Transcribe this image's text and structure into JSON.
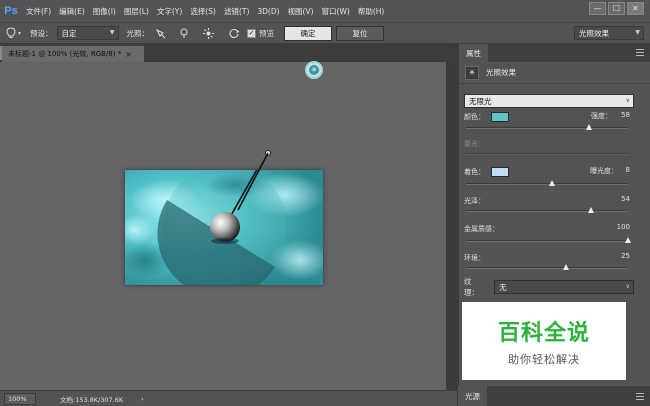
{
  "app": {
    "logo": "Ps"
  },
  "menu": [
    "文件(F)",
    "编辑(E)",
    "图像(I)",
    "图层(L)",
    "文字(Y)",
    "选择(S)",
    "滤镜(T)",
    "3D(D)",
    "视图(V)",
    "窗口(W)",
    "帮助(H)"
  ],
  "window_controls": {
    "minimize": "—",
    "maximize": "☐",
    "close": "✕"
  },
  "options": {
    "preset_label": "预设：",
    "preset_value": "自定",
    "light_label": "光照：",
    "preview_label": "预览",
    "preview_checked": true,
    "ok_label": "确定",
    "reset_label": "复位",
    "workspace_value": "光照效果"
  },
  "document": {
    "tab_title": "未标题-1 @ 100% (光效, RGB/8) *",
    "close": "×"
  },
  "status": {
    "zoom": "100%",
    "doc_size": "文档:153.8K/307.6K",
    "arrow": "›"
  },
  "panel": {
    "tab": "属性",
    "title": "光照效果",
    "light_type": "无限光",
    "color_label": "颜色：",
    "intensity_label": "强度：",
    "intensity": "58",
    "intensity_pct": 0.76,
    "hotspot_label": "聚光：",
    "coloring_label": "着色：",
    "exposure_label": "曝光度：",
    "exposure": "8",
    "exposure_pct": 0.53,
    "gloss_label": "光泽：",
    "gloss": "54",
    "gloss_pct": 0.77,
    "metallic_label": "金属质感：",
    "metallic": "100",
    "metallic_pct": 1.0,
    "ambience_label": "环境：",
    "ambience": "25",
    "ambience_pct": 0.62,
    "texture_label": "纹理：",
    "texture_value": "无",
    "bottom_tab": "光源",
    "colors": {
      "light_color": "#5fc4c7",
      "coloring_color": "#bfe0f4"
    }
  },
  "watermark": {
    "title": "百科全说",
    "subtitle": "助你轻松解决"
  }
}
